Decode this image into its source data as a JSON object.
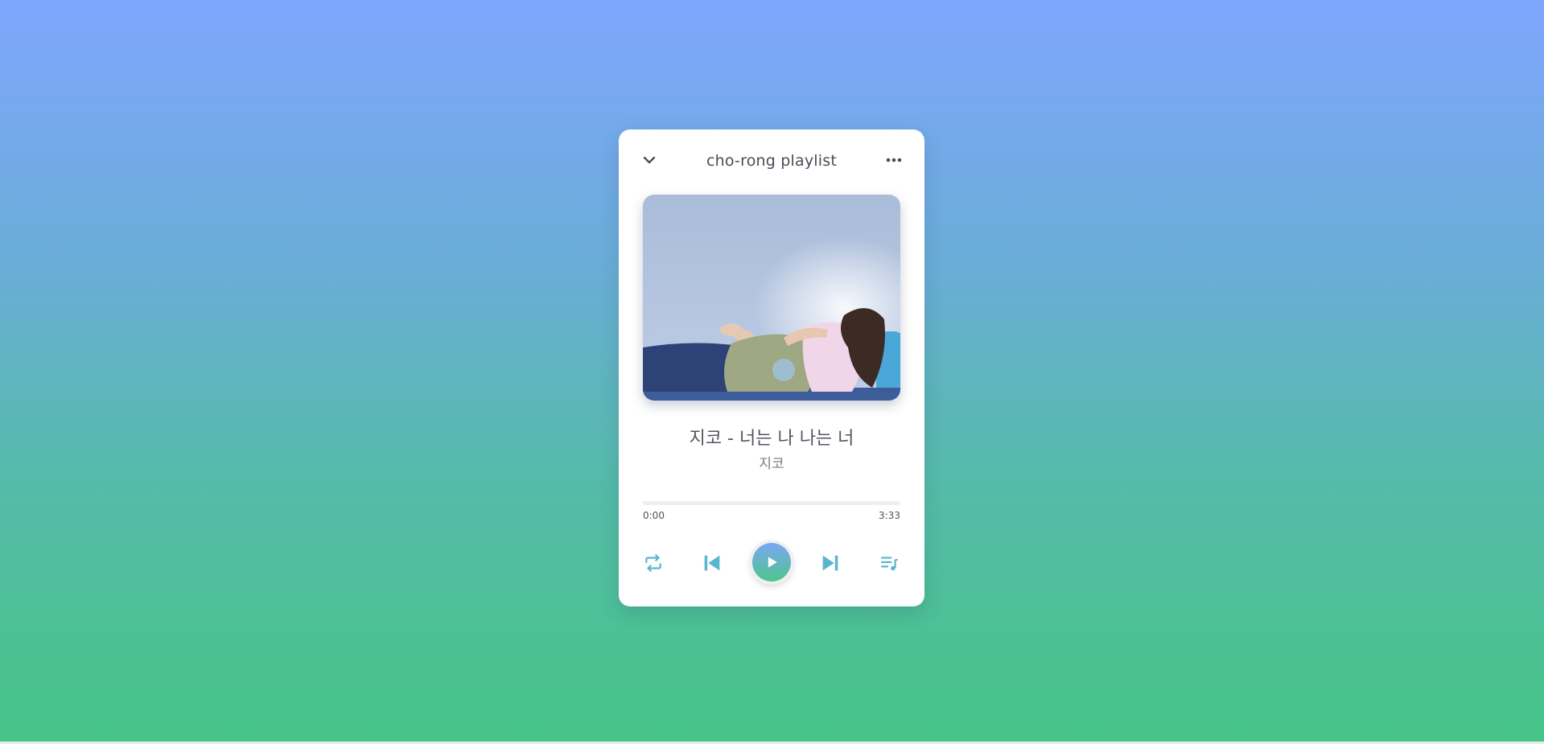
{
  "playlist": {
    "title": "cho-rong playlist"
  },
  "header": {
    "collapse_icon": "chevron-down-icon",
    "menu_icon": "more-horizontal-icon"
  },
  "track": {
    "title": "지코 - 너는 나 나는 너",
    "artist": "지코",
    "current_time": "0:00",
    "duration": "3:33",
    "progress": 0
  },
  "controls": {
    "repeat_icon": "repeat-icon",
    "previous_icon": "skip-previous-icon",
    "play_icon": "play-icon",
    "next_icon": "skip-next-icon",
    "queue_icon": "playlist-music-icon"
  },
  "colors": {
    "accent": "#5ab5cf",
    "play_gradient_top": "#79a7f5",
    "play_gradient_bottom": "#4fc58a",
    "background_top": "#7fa6fd",
    "background_bottom": "#46c487"
  }
}
